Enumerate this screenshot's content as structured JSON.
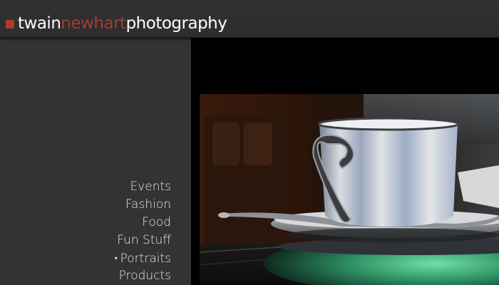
{
  "brand": {
    "part1": "twain",
    "part2": "newhart",
    "part3": "photography",
    "accent_color": "#a83a2e",
    "icon": "red-square-mark"
  },
  "nav": {
    "items": [
      {
        "label": "Events",
        "expanded": false
      },
      {
        "label": "Fashion",
        "expanded": false
      },
      {
        "label": "Food",
        "expanded": false
      },
      {
        "label": "Fun Stuff",
        "expanded": false
      },
      {
        "label": "Portraits",
        "expanded": true,
        "caret": "▾"
      },
      {
        "label": "Products",
        "expanded": false
      }
    ]
  },
  "photo": {
    "subject": "coffee-cup-on-saucer"
  }
}
